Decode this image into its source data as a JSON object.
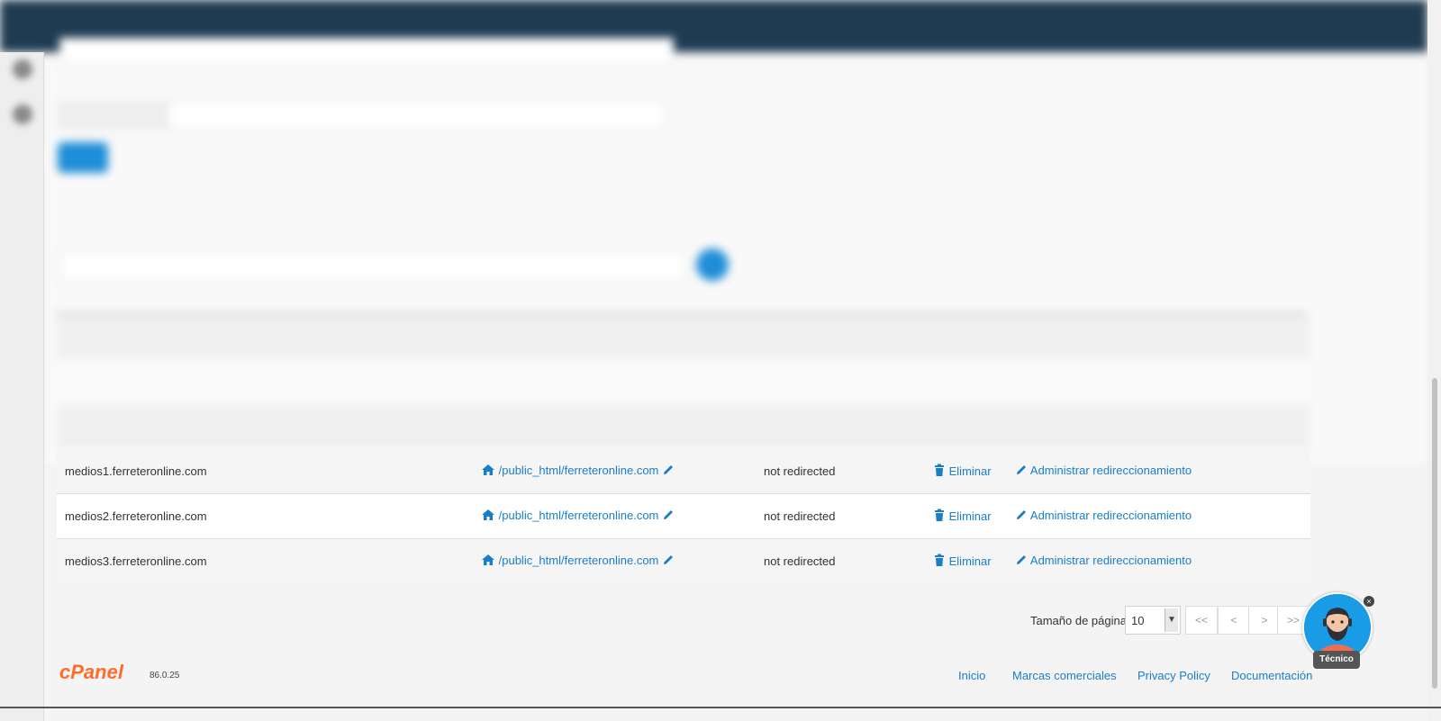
{
  "table": {
    "rows": [
      {
        "subdomain": "medios1.ferreteronline.com",
        "docroot": "/public_html/ferreteronline.com",
        "redirection": "not redirected",
        "delete_label": "Eliminar",
        "manage_label": "Administrar redireccionamiento"
      },
      {
        "subdomain": "medios2.ferreteronline.com",
        "docroot": "/public_html/ferreteronline.com",
        "redirection": "not redirected",
        "delete_label": "Eliminar",
        "manage_label": "Administrar redireccionamiento"
      },
      {
        "subdomain": "medios3.ferreteronline.com",
        "docroot": "/public_html/ferreteronline.com",
        "redirection": "not redirected",
        "delete_label": "Eliminar",
        "manage_label": "Administrar redireccionamiento"
      }
    ]
  },
  "pagination": {
    "page_size_label": "Tamaño de página",
    "page_size_value": "10",
    "first": "<<",
    "prev": "<",
    "next": ">",
    "last": ">>"
  },
  "footer": {
    "logo": "cPanel",
    "version": "86.0.25",
    "links": [
      "Inicio",
      "Marcas comerciales",
      "Privacy Policy",
      "Documentación"
    ]
  },
  "chat_widget": {
    "label": "Técnico",
    "close": "×"
  },
  "colors": {
    "link": "#1a7ec6",
    "topbar": "#1f3b52",
    "brand_orange": "#ff6c2c",
    "accent_blue": "#1a9be6"
  }
}
